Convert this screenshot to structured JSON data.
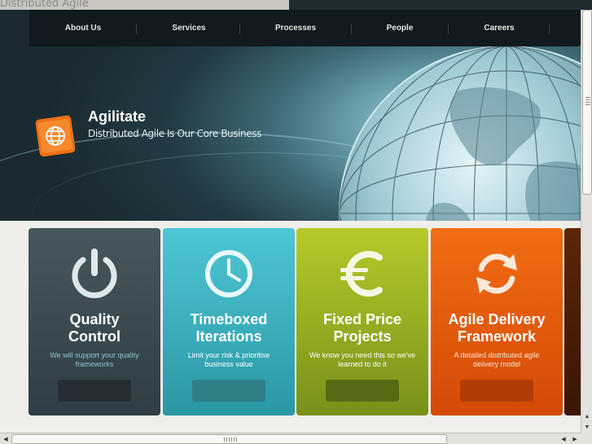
{
  "window": {
    "title": "Distributed Agile"
  },
  "nav": {
    "items": [
      {
        "label": "About Us"
      },
      {
        "label": "Services"
      },
      {
        "label": "Processes"
      },
      {
        "label": "People"
      },
      {
        "label": "Careers"
      }
    ]
  },
  "brand": {
    "name": "Agilitate",
    "tagline": "Distributed Agile Is Our Core Business",
    "logo_icon": "globe-icon"
  },
  "cards": [
    {
      "title_line1": "Quality",
      "title_line2": "Control",
      "description": "We will support your quality frameworks",
      "icon": "power-icon",
      "color": "#3b4a50"
    },
    {
      "title_line1": "Timeboxed",
      "title_line2": "Iterations",
      "description": "Limit your risk & prioritise business value",
      "icon": "clock-icon",
      "color": "#3bb3c2"
    },
    {
      "title_line1": "Fixed Price",
      "title_line2": "Projects",
      "description": "We know you need this so we've learned to do it",
      "icon": "euro-icon",
      "color": "#98ad22"
    },
    {
      "title_line1": "Agile Delivery",
      "title_line2": "Framework",
      "description": "A detailed distributed agile delivery model",
      "icon": "cycle-arrows-icon",
      "color": "#e65c0c"
    }
  ],
  "colors": {
    "navbar": "#111a1e",
    "accent_orange": "#ee6a10",
    "page_background": "#f0eeea"
  }
}
